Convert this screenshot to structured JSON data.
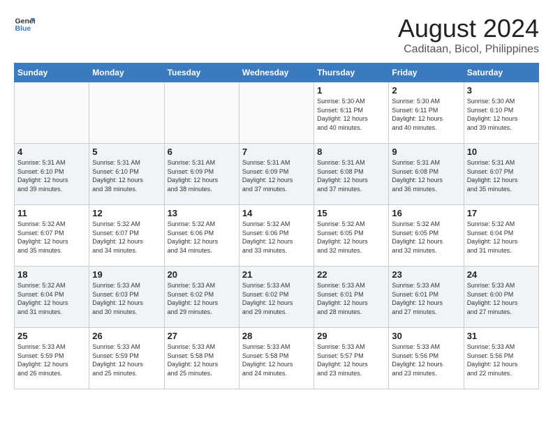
{
  "header": {
    "logo_line1": "General",
    "logo_line2": "Blue",
    "title": "August 2024",
    "subtitle": "Caditaan, Bicol, Philippines"
  },
  "days_of_week": [
    "Sunday",
    "Monday",
    "Tuesday",
    "Wednesday",
    "Thursday",
    "Friday",
    "Saturday"
  ],
  "weeks": [
    [
      {
        "num": "",
        "info": ""
      },
      {
        "num": "",
        "info": ""
      },
      {
        "num": "",
        "info": ""
      },
      {
        "num": "",
        "info": ""
      },
      {
        "num": "1",
        "info": "Sunrise: 5:30 AM\nSunset: 6:11 PM\nDaylight: 12 hours\nand 40 minutes."
      },
      {
        "num": "2",
        "info": "Sunrise: 5:30 AM\nSunset: 6:11 PM\nDaylight: 12 hours\nand 40 minutes."
      },
      {
        "num": "3",
        "info": "Sunrise: 5:30 AM\nSunset: 6:10 PM\nDaylight: 12 hours\nand 39 minutes."
      }
    ],
    [
      {
        "num": "4",
        "info": "Sunrise: 5:31 AM\nSunset: 6:10 PM\nDaylight: 12 hours\nand 39 minutes."
      },
      {
        "num": "5",
        "info": "Sunrise: 5:31 AM\nSunset: 6:10 PM\nDaylight: 12 hours\nand 38 minutes."
      },
      {
        "num": "6",
        "info": "Sunrise: 5:31 AM\nSunset: 6:09 PM\nDaylight: 12 hours\nand 38 minutes."
      },
      {
        "num": "7",
        "info": "Sunrise: 5:31 AM\nSunset: 6:09 PM\nDaylight: 12 hours\nand 37 minutes."
      },
      {
        "num": "8",
        "info": "Sunrise: 5:31 AM\nSunset: 6:08 PM\nDaylight: 12 hours\nand 37 minutes."
      },
      {
        "num": "9",
        "info": "Sunrise: 5:31 AM\nSunset: 6:08 PM\nDaylight: 12 hours\nand 36 minutes."
      },
      {
        "num": "10",
        "info": "Sunrise: 5:31 AM\nSunset: 6:07 PM\nDaylight: 12 hours\nand 35 minutes."
      }
    ],
    [
      {
        "num": "11",
        "info": "Sunrise: 5:32 AM\nSunset: 6:07 PM\nDaylight: 12 hours\nand 35 minutes."
      },
      {
        "num": "12",
        "info": "Sunrise: 5:32 AM\nSunset: 6:07 PM\nDaylight: 12 hours\nand 34 minutes."
      },
      {
        "num": "13",
        "info": "Sunrise: 5:32 AM\nSunset: 6:06 PM\nDaylight: 12 hours\nand 34 minutes."
      },
      {
        "num": "14",
        "info": "Sunrise: 5:32 AM\nSunset: 6:06 PM\nDaylight: 12 hours\nand 33 minutes."
      },
      {
        "num": "15",
        "info": "Sunrise: 5:32 AM\nSunset: 6:05 PM\nDaylight: 12 hours\nand 32 minutes."
      },
      {
        "num": "16",
        "info": "Sunrise: 5:32 AM\nSunset: 6:05 PM\nDaylight: 12 hours\nand 32 minutes."
      },
      {
        "num": "17",
        "info": "Sunrise: 5:32 AM\nSunset: 6:04 PM\nDaylight: 12 hours\nand 31 minutes."
      }
    ],
    [
      {
        "num": "18",
        "info": "Sunrise: 5:32 AM\nSunset: 6:04 PM\nDaylight: 12 hours\nand 31 minutes."
      },
      {
        "num": "19",
        "info": "Sunrise: 5:33 AM\nSunset: 6:03 PM\nDaylight: 12 hours\nand 30 minutes."
      },
      {
        "num": "20",
        "info": "Sunrise: 5:33 AM\nSunset: 6:02 PM\nDaylight: 12 hours\nand 29 minutes."
      },
      {
        "num": "21",
        "info": "Sunrise: 5:33 AM\nSunset: 6:02 PM\nDaylight: 12 hours\nand 29 minutes."
      },
      {
        "num": "22",
        "info": "Sunrise: 5:33 AM\nSunset: 6:01 PM\nDaylight: 12 hours\nand 28 minutes."
      },
      {
        "num": "23",
        "info": "Sunrise: 5:33 AM\nSunset: 6:01 PM\nDaylight: 12 hours\nand 27 minutes."
      },
      {
        "num": "24",
        "info": "Sunrise: 5:33 AM\nSunset: 6:00 PM\nDaylight: 12 hours\nand 27 minutes."
      }
    ],
    [
      {
        "num": "25",
        "info": "Sunrise: 5:33 AM\nSunset: 5:59 PM\nDaylight: 12 hours\nand 26 minutes."
      },
      {
        "num": "26",
        "info": "Sunrise: 5:33 AM\nSunset: 5:59 PM\nDaylight: 12 hours\nand 25 minutes."
      },
      {
        "num": "27",
        "info": "Sunrise: 5:33 AM\nSunset: 5:58 PM\nDaylight: 12 hours\nand 25 minutes."
      },
      {
        "num": "28",
        "info": "Sunrise: 5:33 AM\nSunset: 5:58 PM\nDaylight: 12 hours\nand 24 minutes."
      },
      {
        "num": "29",
        "info": "Sunrise: 5:33 AM\nSunset: 5:57 PM\nDaylight: 12 hours\nand 23 minutes."
      },
      {
        "num": "30",
        "info": "Sunrise: 5:33 AM\nSunset: 5:56 PM\nDaylight: 12 hours\nand 23 minutes."
      },
      {
        "num": "31",
        "info": "Sunrise: 5:33 AM\nSunset: 5:56 PM\nDaylight: 12 hours\nand 22 minutes."
      }
    ]
  ]
}
